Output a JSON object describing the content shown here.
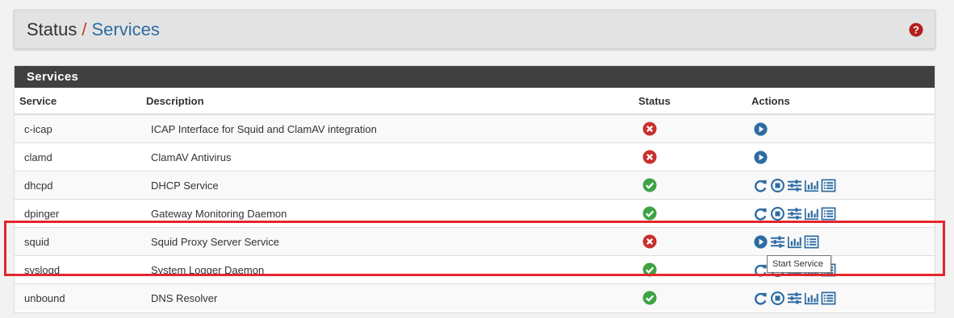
{
  "breadcrumb": {
    "root": "Status",
    "separator": "/",
    "current": "Services"
  },
  "panel": {
    "title": "Services"
  },
  "table": {
    "headers": {
      "service": "Service",
      "description": "Description",
      "status": "Status",
      "actions": "Actions"
    },
    "rows": [
      {
        "service": "c-icap",
        "description": "ICAP Interface for Squid and ClamAV integration",
        "status": "stopped",
        "actions": [
          "start-service-icon"
        ]
      },
      {
        "service": "clamd",
        "description": "ClamAV Antivirus",
        "status": "stopped",
        "actions": [
          "start-service-icon"
        ]
      },
      {
        "service": "dhcpd",
        "description": "DHCP Service",
        "status": "running",
        "actions": [
          "restart-service-icon",
          "stop-service-icon",
          "settings-icon",
          "status-graph-icon",
          "logs-icon"
        ]
      },
      {
        "service": "dpinger",
        "description": "Gateway Monitoring Daemon",
        "status": "running",
        "actions": [
          "restart-service-icon",
          "stop-service-icon",
          "settings-icon",
          "status-graph-icon",
          "logs-icon"
        ]
      },
      {
        "service": "squid",
        "description": "Squid Proxy Server Service",
        "status": "stopped",
        "actions": [
          "start-service-icon",
          "settings-icon",
          "status-graph-icon",
          "logs-icon"
        ]
      },
      {
        "service": "syslogd",
        "description": "System Logger Daemon",
        "status": "running",
        "actions": [
          "restart-service-icon",
          "stop-service-icon",
          "settings-icon",
          "status-graph-icon",
          "logs-icon"
        ]
      },
      {
        "service": "unbound",
        "description": "DNS Resolver",
        "status": "running",
        "actions": [
          "restart-service-icon",
          "stop-service-icon",
          "settings-icon",
          "status-graph-icon",
          "logs-icon"
        ]
      }
    ]
  },
  "tooltip": {
    "text": "Start Service"
  },
  "colors": {
    "link_blue": "#2d6ca2",
    "running_green": "#3fa345",
    "stopped_red": "#c9302c",
    "highlight_red": "#e4262c",
    "header_dark": "#404040"
  }
}
